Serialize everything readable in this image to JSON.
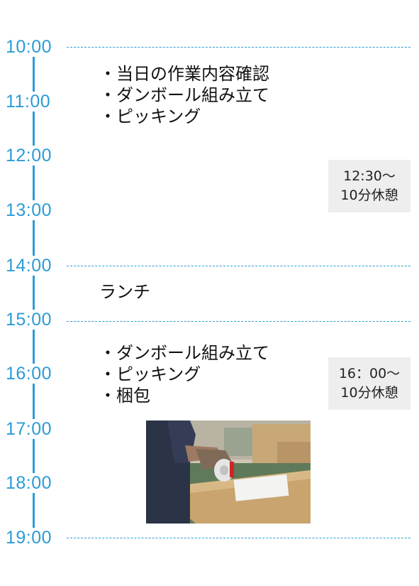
{
  "timeline": {
    "hours": [
      "10:00",
      "11:00",
      "12:00",
      "13:00",
      "14:00",
      "15:00",
      "16:00",
      "17:00",
      "18:00",
      "19:00"
    ]
  },
  "morning": {
    "tasks": [
      "当日の作業内容確認",
      "ダンボール組み立て",
      "ピッキング"
    ],
    "break": {
      "time": "12:30～",
      "duration": "10分休憩"
    }
  },
  "lunch": {
    "label": "ランチ"
  },
  "afternoon": {
    "tasks": [
      "ダンボール組み立て",
      "ピッキング",
      "梱包"
    ],
    "break": {
      "time": "16：00～",
      "duration": "10分休憩"
    }
  },
  "colors": {
    "accent": "#2b9bd7",
    "break_bg": "#eeeeee"
  }
}
